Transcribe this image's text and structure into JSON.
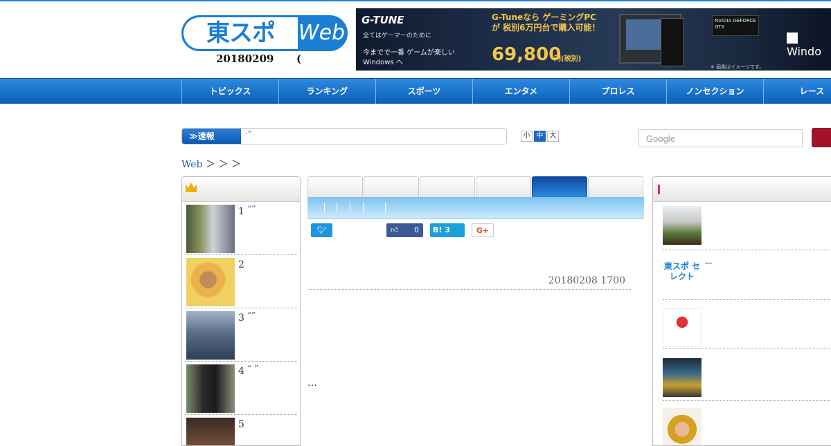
{
  "header": {
    "logo_jp": "東スポ",
    "logo_web": "Web",
    "date": "20180209",
    "date_paren": "("
  },
  "banner": {
    "brand": "G-TUNE",
    "tagline": "全てはゲーマーのために",
    "copy": "今までで一番 ゲームが楽しい Windows へ",
    "headline": "G-Tuneなら ゲーミングPCが 税別6万円台で購入可能！",
    "price": "69,800",
    "price_suffix": "円(税別)",
    "gpu": "NVIDIA GEFORCE GTX",
    "note": "※ 画像はイメージです。",
    "windows": "Windo"
  },
  "nav": {
    "items": [
      "トピックス",
      "ランキング",
      "スポーツ",
      "エンタメ",
      "プロレス",
      "ノンセクション",
      "レース"
    ]
  },
  "breaking": {
    "label": "≫速報",
    "text": "·“"
  },
  "font_size": {
    "small": "小",
    "medium": "中",
    "large": "大",
    "selected": "中"
  },
  "search": {
    "placeholder": "Google"
  },
  "breadcrumb": {
    "home": "Web",
    "separators": "＞ ＞ ＞"
  },
  "ranking": {
    "items": [
      {
        "rank": "1",
        "title": "“”"
      },
      {
        "rank": "2",
        "title": ""
      },
      {
        "rank": "3",
        "title": "“”"
      },
      {
        "rank": "4",
        "title": "“ ”"
      },
      {
        "rank": "5",
        "title": ""
      }
    ]
  },
  "share": {
    "facebook_count": "0",
    "hatena_label": "B!",
    "hatena_count": "3",
    "gplus_label": "G+"
  },
  "article": {
    "published": "20180208 1700",
    "ellipsis": "…"
  },
  "sidebar": {
    "select_logo": "東スポ セレクト",
    "select_link": "—"
  },
  "colors": {
    "brand_blue": "#1a7fd4",
    "nav_blue": "#0b5fb6",
    "link": "#1a5fa8",
    "search_button": "#a3122a"
  }
}
